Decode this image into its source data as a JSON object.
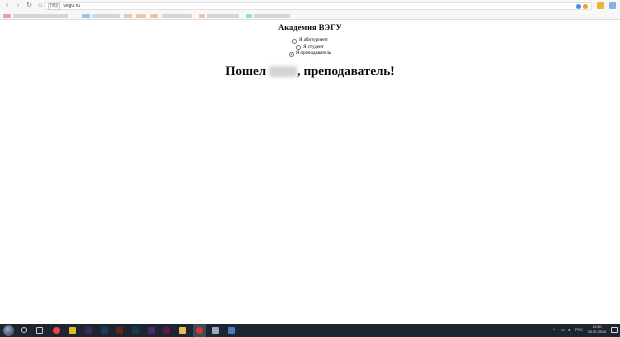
{
  "browser": {
    "scheme_badge": "http",
    "url": "vegu.ru"
  },
  "page": {
    "title": "Академия ВЭГУ",
    "roles": [
      {
        "label": "Я абитуриент",
        "checked": false
      },
      {
        "label": "Я студент",
        "checked": false
      },
      {
        "label": "Я преподаватель",
        "checked": true
      }
    ],
    "greeting_prefix": "Пошел",
    "greeting_suffix": ", преподаватель!"
  },
  "taskbar": {
    "language": "РУС",
    "time": "12:20",
    "date": "20.07.2019"
  },
  "colors": {
    "toolbar_bg": "#f7f7f7",
    "taskbar_bg": "#1c2530"
  }
}
